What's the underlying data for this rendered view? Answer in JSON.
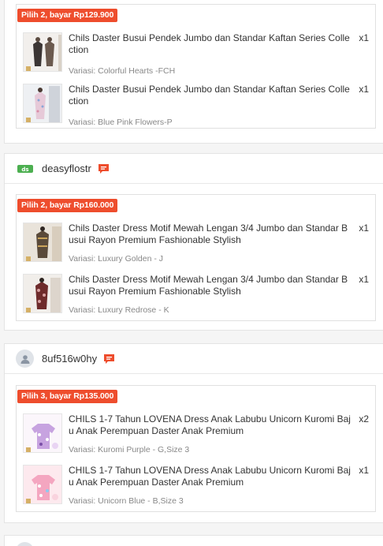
{
  "colors": {
    "accent": "#ee4d2d",
    "muted": "#888888"
  },
  "orders": [
    {
      "shop": null,
      "bundle_tag": "Pilih 2, bayar Rp129.900",
      "items": [
        {
          "name": "Chils Daster Busui Pendek Jumbo dan Standar Kaftan Series Collection",
          "qty": "x1",
          "variant": "Variasi: Colorful Hearts -FCH"
        },
        {
          "name": "Chils Daster Busui Pendek Jumbo dan Standar Kaftan Series Collection",
          "qty": "x1",
          "variant": "Variasi: Blue Pink Flowers-P"
        }
      ]
    },
    {
      "shop": {
        "name": "deasyflostr",
        "avatar_icon": "shop-logo-icon",
        "chat_icon": "chat-icon"
      },
      "bundle_tag": "Pilih 2, bayar Rp160.000",
      "items": [
        {
          "name": "Chils Daster Dress Motif Mewah Lengan 3/4 Jumbo dan Standar Busui Rayon Premium Fashionable Stylish",
          "qty": "x1",
          "variant": "Variasi: Luxury Golden - J"
        },
        {
          "name": "Chils Daster Dress Motif Mewah Lengan 3/4 Jumbo dan Standar Busui Rayon Premium Fashionable Stylish",
          "qty": "x1",
          "variant": "Variasi: Luxury Redrose - K"
        }
      ]
    },
    {
      "shop": {
        "name": "8uf516w0hy",
        "avatar_icon": "user-avatar-icon",
        "chat_icon": "chat-icon"
      },
      "bundle_tag": "Pilih 3, bayar Rp135.000",
      "items": [
        {
          "name": "CHILS 1-7 Tahun LOVENA Dress Anak Labubu Unicorn Kuromi Baju Anak Perempuan Daster Anak Premium",
          "qty": "x2",
          "variant": "Variasi: Kuromi Purple - G,Size 3"
        },
        {
          "name": "CHILS 1-7 Tahun LOVENA Dress Anak Labubu Unicorn Kuromi Baju Anak Perempuan Daster Anak Premium",
          "qty": "x1",
          "variant": "Variasi: Unicorn Blue - B,Size 3"
        }
      ]
    }
  ]
}
